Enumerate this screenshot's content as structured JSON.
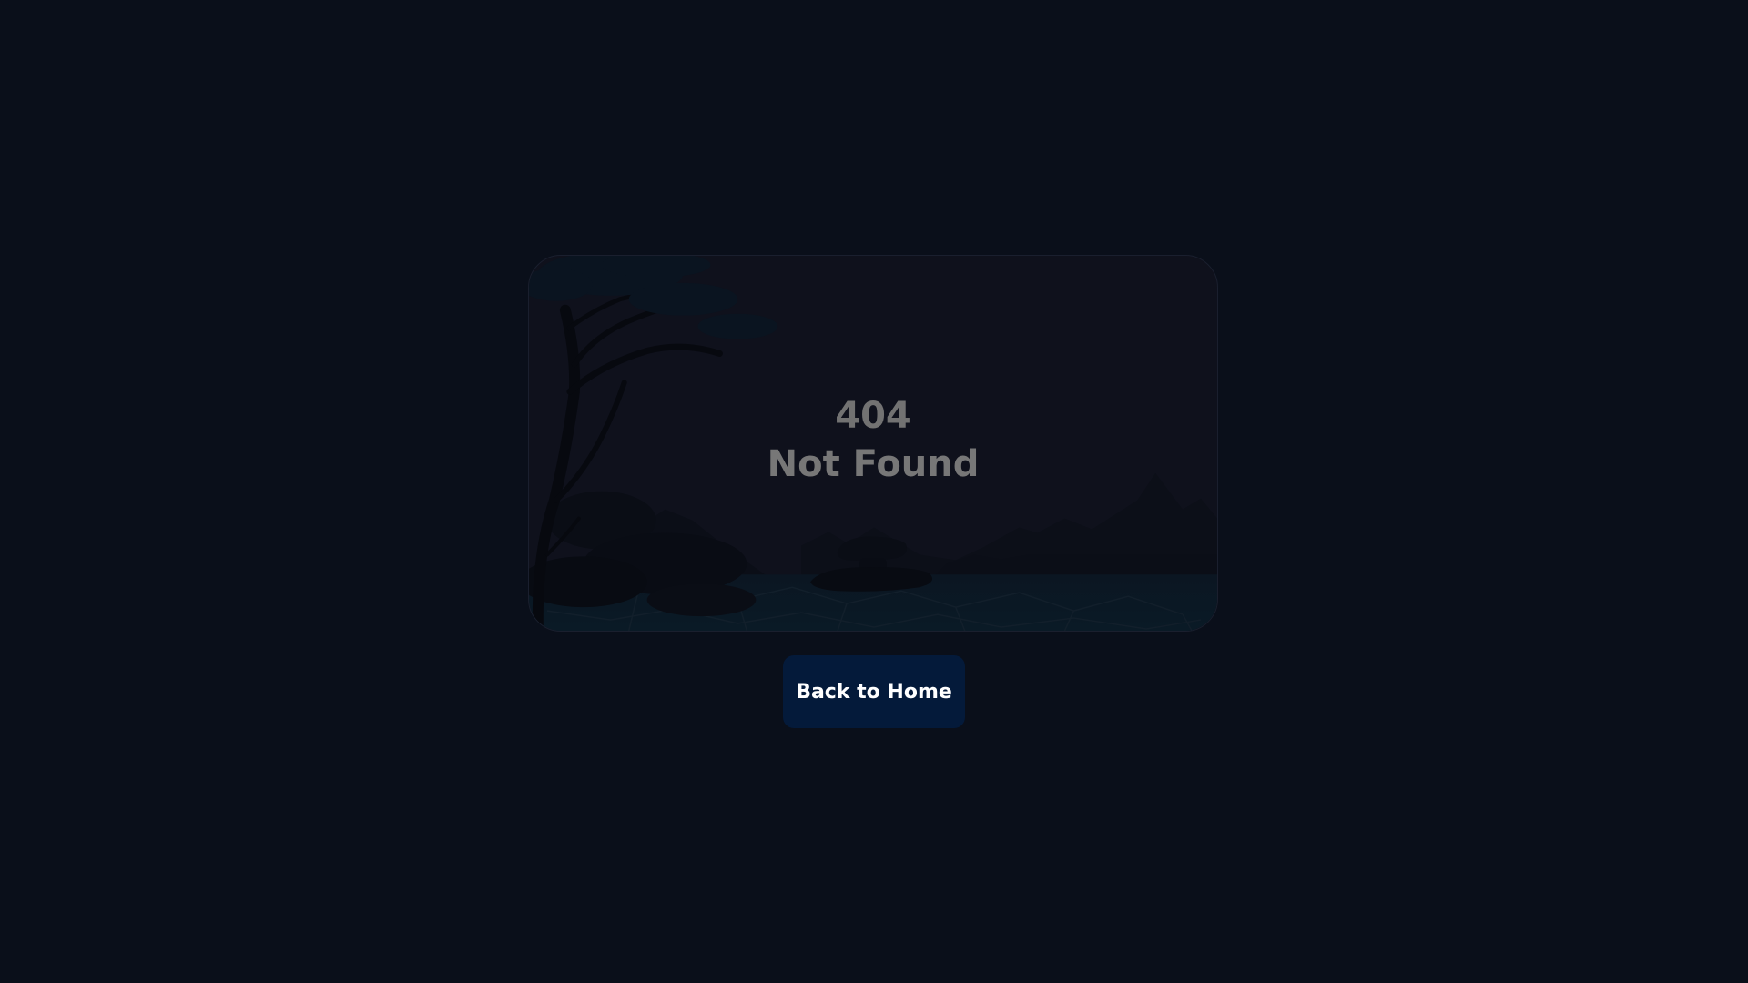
{
  "error": {
    "code": "404",
    "message": "Not Found"
  },
  "actions": {
    "home_label": "Back to Home"
  },
  "colors": {
    "background": "#0a0f1a",
    "card": "#0f111c",
    "text_muted": "#777777",
    "button": "#041a3a",
    "button_text": "#ffffff"
  },
  "illustration": {
    "name": "tree-rocks-mountains-illustration"
  }
}
